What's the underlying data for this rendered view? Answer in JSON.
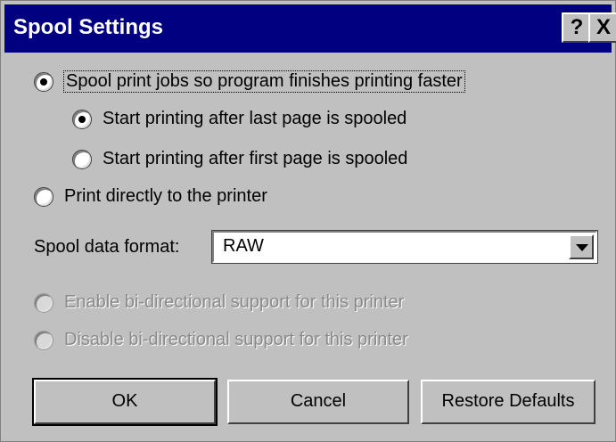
{
  "window": {
    "title": "Spool Settings",
    "help_label": "?",
    "close_label": "X"
  },
  "options": {
    "spool": "Spool print jobs so program finishes printing faster",
    "after_last": "Start printing after last page is spooled",
    "after_first": "Start printing after first page is spooled",
    "direct": "Print directly to the printer"
  },
  "format": {
    "label": "Spool data format:",
    "value": "RAW"
  },
  "bidi": {
    "enable": "Enable bi-directional support for this printer",
    "disable": "Disable bi-directional support for this printer"
  },
  "buttons": {
    "ok": "OK",
    "cancel": "Cancel",
    "restore": "Restore Defaults"
  },
  "state": {
    "spool_selected": true,
    "after_last_selected": true,
    "bidi_enabled": false
  }
}
